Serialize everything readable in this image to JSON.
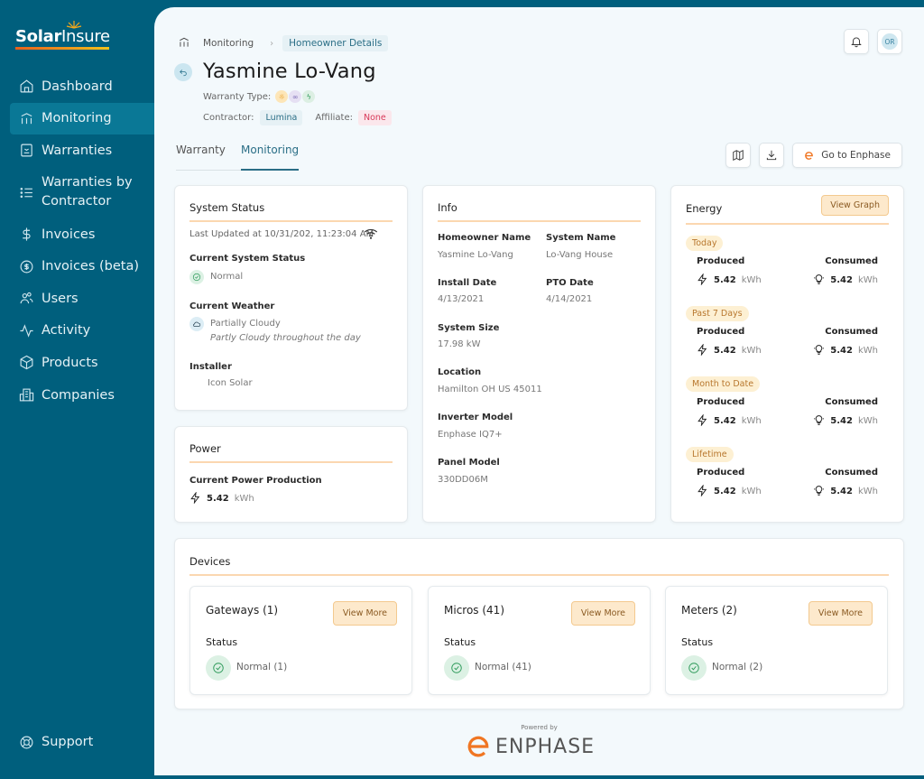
{
  "app": {
    "brand_bold": "Solar",
    "brand_light": "Insure",
    "colors": {
      "sidebar": "#005f7d",
      "accent": "#2a6e86",
      "warning_bg": "#fde9cc",
      "success": "#2e9a5a",
      "enphase_orange": "#f07623"
    }
  },
  "sidebar": {
    "items": [
      {
        "label": "Dashboard",
        "icon": "home-icon"
      },
      {
        "label": "Monitoring",
        "icon": "monitoring-icon",
        "active": true
      },
      {
        "label": "Warranties",
        "icon": "warranty-icon"
      },
      {
        "label": "Warranties by Contractor",
        "line1": "Warranties by",
        "line2": "Contractor",
        "icon": "list-icon"
      },
      {
        "label": "Invoices",
        "icon": "dollar-icon"
      },
      {
        "label": "Invoices (beta)",
        "icon": "dollar-circle-icon"
      },
      {
        "label": "Users",
        "icon": "users-icon"
      },
      {
        "label": "Activity",
        "icon": "activity-icon"
      },
      {
        "label": "Products",
        "icon": "box-icon"
      },
      {
        "label": "Companies",
        "icon": "building-icon"
      }
    ],
    "support": "Support"
  },
  "breadcrumb": {
    "parent": "Monitoring",
    "current": "Homeowner Details"
  },
  "header": {
    "avatar_initials": "OR",
    "title": "Yasmine Lo-Vang",
    "warranty_type_label": "Warranty Type:",
    "warranty_types": [
      "solar",
      "link",
      "bolt"
    ],
    "contractor_label": "Contractor:",
    "contractor": "Lumina",
    "affiliate_label": "Affiliate:",
    "affiliate": "None"
  },
  "tabs": [
    {
      "label": "Warranty",
      "active": false
    },
    {
      "label": "Monitoring",
      "active": true
    }
  ],
  "toolbar": {
    "go_to_enphase": "Go to Enphase"
  },
  "system_status": {
    "title": "System Status",
    "last_updated": "Last Updated at 10/31/202, 11:23:04 AM",
    "status_label": "Current System Status",
    "status_value": "Normal",
    "weather_label": "Current Weather",
    "weather_value": "Partially Cloudy",
    "weather_desc": "Partly Cloudy throughout the day",
    "installer_label": "Installer",
    "installer_value": "Icon Solar"
  },
  "power": {
    "title": "Power",
    "label": "Current Power Production",
    "value": "5.42",
    "unit": "kWh"
  },
  "info": {
    "title": "Info",
    "fields": {
      "homeowner_name": {
        "label": "Homeowner Name",
        "value": "Yasmine Lo-Vang"
      },
      "system_name": {
        "label": "System Name",
        "value": "Lo-Vang House"
      },
      "install_date": {
        "label": "Install Date",
        "value": "4/13/2021"
      },
      "pto_date": {
        "label": "PTO Date",
        "value": "4/14/2021"
      },
      "system_size": {
        "label": "System Size",
        "value": "17.98 kW"
      },
      "location": {
        "label": "Location",
        "value": "Hamilton OH US 45011"
      },
      "inverter_model": {
        "label": "Inverter Model",
        "value": "Enphase IQ7+"
      },
      "panel_model": {
        "label": "Panel Model",
        "value": "330DD06M"
      }
    }
  },
  "energy": {
    "title": "Energy",
    "view_graph": "View Graph",
    "produced_label": "Produced",
    "consumed_label": "Consumed",
    "unit": "kWh",
    "periods": [
      {
        "label": "Today",
        "produced": "5.42",
        "consumed": "5.42"
      },
      {
        "label": "Past 7 Days",
        "produced": "5.42",
        "consumed": "5.42"
      },
      {
        "label": "Month to Date",
        "produced": "5.42",
        "consumed": "5.42"
      },
      {
        "label": "Lifetime",
        "produced": "5.42",
        "consumed": "5.42"
      }
    ]
  },
  "devices": {
    "title": "Devices",
    "view_more": "View More",
    "status_label": "Status",
    "items": [
      {
        "name": "Gateways (1)",
        "status": "Normal (1)"
      },
      {
        "name": "Micros (41)",
        "status": "Normal (41)"
      },
      {
        "name": "Meters (2)",
        "status": "Normal (2)"
      }
    ]
  },
  "footer": {
    "powered_by": "Powered by",
    "brand": "ENPHASE"
  }
}
